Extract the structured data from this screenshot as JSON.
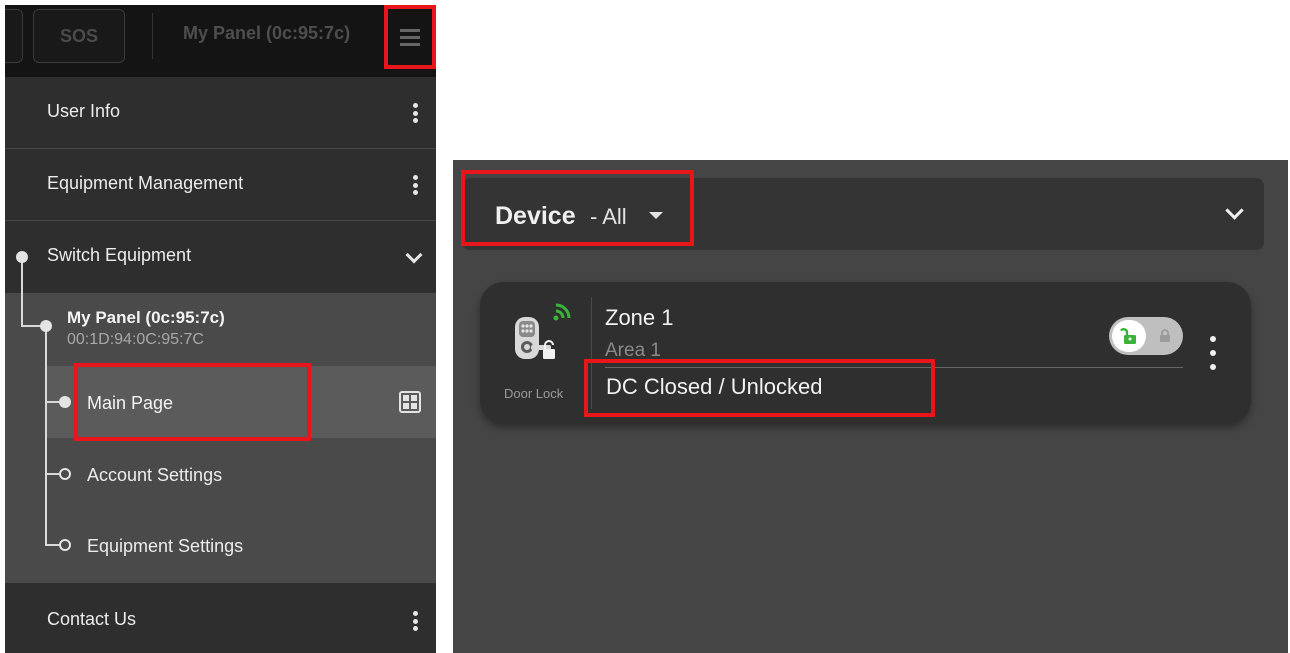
{
  "left_panel": {
    "topbar": {
      "sos_label": "SOS",
      "panel_title": "My Panel (0c:95:7c)",
      "menu_icon": "hamburger-icon"
    },
    "menu": {
      "user_info": "User Info",
      "equipment_management": "Equipment Management",
      "switch_equipment": "Switch Equipment",
      "contact_us": "Contact Us"
    },
    "panel": {
      "name": "My Panel (0c:95:7c)",
      "mac": "00:1D:94:0C:95:7C"
    },
    "sub_items": {
      "main_page": "Main Page",
      "account_settings": "Account Settings",
      "equipment_settings": "Equipment Settings"
    },
    "icons": {
      "more": "kebab-icon",
      "expand": "chevron-down-icon",
      "dashboard": "dashboard-icon"
    }
  },
  "right_panel": {
    "header": {
      "title": "Device",
      "filter": "- All"
    },
    "device": {
      "type": "Door Lock",
      "zone": "Zone 1",
      "area": "Area 1",
      "status": "DC Closed / Unlocked",
      "lock_state": "unlocked"
    }
  },
  "colors": {
    "highlight": "#e8151b",
    "signal_green": "#3bb33b"
  }
}
